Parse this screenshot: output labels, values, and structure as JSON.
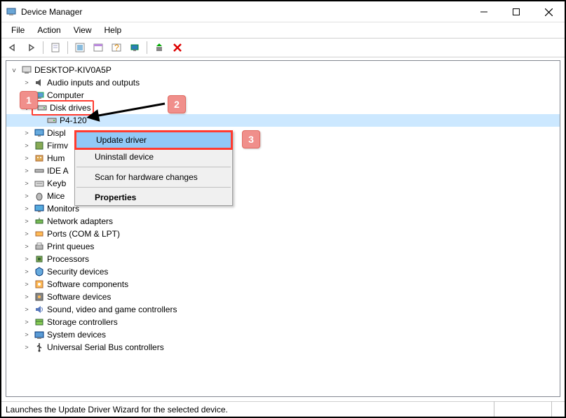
{
  "titlebar": {
    "title": "Device Manager"
  },
  "menubar": {
    "file": "File",
    "action": "Action",
    "view": "View",
    "help": "Help"
  },
  "toolbar": {
    "back": "←",
    "forward": "→",
    "icons": [
      "properties-icon",
      "help-topics-icon",
      "action-icon",
      "options-icon",
      "scan-icon",
      "update-icon",
      "uninstall-icon"
    ],
    "delete": "✕"
  },
  "tree": {
    "root": "DESKTOP-KIV0A5P",
    "categories": [
      {
        "label": "Audio inputs and outputs",
        "twisty": ">",
        "icon": "audio-icon"
      },
      {
        "label": "Computer",
        "twisty": ">",
        "icon": "computer-icon"
      },
      {
        "label": "Disk drives",
        "twisty": "v",
        "icon": "disk-icon",
        "highlight": true,
        "children": [
          {
            "label": "P4-120",
            "icon": "disk-icon",
            "selected": true
          }
        ]
      },
      {
        "label": "Displ",
        "twisty": ">",
        "icon": "display-icon"
      },
      {
        "label": "Firmv",
        "twisty": ">",
        "icon": "firmware-icon"
      },
      {
        "label": "Hum",
        "twisty": ">",
        "icon": "hid-icon"
      },
      {
        "label": "IDE A",
        "twisty": ">",
        "icon": "ide-icon"
      },
      {
        "label": "Keyb",
        "twisty": ">",
        "icon": "keyboard-icon"
      },
      {
        "label": "Mice",
        "twisty": ">",
        "icon": "mouse-icon"
      },
      {
        "label": "Monitors",
        "twisty": ">",
        "icon": "monitor-icon"
      },
      {
        "label": "Network adapters",
        "twisty": ">",
        "icon": "network-icon"
      },
      {
        "label": "Ports (COM & LPT)",
        "twisty": ">",
        "icon": "ports-icon"
      },
      {
        "label": "Print queues",
        "twisty": ">",
        "icon": "printer-icon"
      },
      {
        "label": "Processors",
        "twisty": ">",
        "icon": "cpu-icon"
      },
      {
        "label": "Security devices",
        "twisty": ">",
        "icon": "security-icon"
      },
      {
        "label": "Software components",
        "twisty": ">",
        "icon": "sw-comp-icon"
      },
      {
        "label": "Software devices",
        "twisty": ">",
        "icon": "sw-dev-icon"
      },
      {
        "label": "Sound, video and game controllers",
        "twisty": ">",
        "icon": "sound-icon"
      },
      {
        "label": "Storage controllers",
        "twisty": ">",
        "icon": "storage-icon"
      },
      {
        "label": "System devices",
        "twisty": ">",
        "icon": "system-icon"
      },
      {
        "label": "Universal Serial Bus controllers",
        "twisty": ">",
        "icon": "usb-icon"
      }
    ]
  },
  "context_menu": {
    "update": "Update driver",
    "uninstall": "Uninstall device",
    "scan": "Scan for hardware changes",
    "properties": "Properties"
  },
  "statusbar": {
    "text": "Launches the Update Driver Wizard for the selected device."
  },
  "callouts": {
    "c1": "1",
    "c2": "2",
    "c3": "3"
  }
}
